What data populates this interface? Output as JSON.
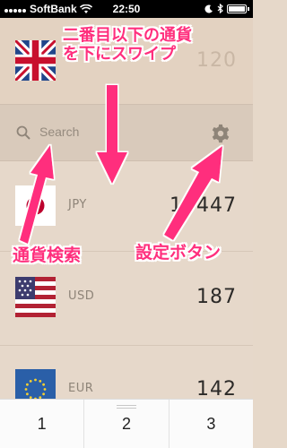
{
  "status_bar": {
    "carrier": "SoftBank",
    "time": "22:50"
  },
  "base_currency": {
    "code": "GBP",
    "amount": "120",
    "flag": "uk-flag"
  },
  "search": {
    "placeholder": "Search"
  },
  "currencies": [
    {
      "code": "JPY",
      "amount": "18447",
      "flag": "japan-flag"
    },
    {
      "code": "USD",
      "amount": "187",
      "flag": "us-flag"
    },
    {
      "code": "EUR",
      "amount": "142",
      "flag": "eu-flag"
    }
  ],
  "keypad": {
    "keys": [
      "1",
      "2",
      "3"
    ]
  },
  "annotations": {
    "top_line1": "二番目以下の通貨",
    "top_line2": "を下にスワイプ",
    "search_label": "通貨検索",
    "settings_label": "設定ボタン"
  },
  "colors": {
    "annotation": "#ff2f7d",
    "background": "#e6d8c9"
  }
}
